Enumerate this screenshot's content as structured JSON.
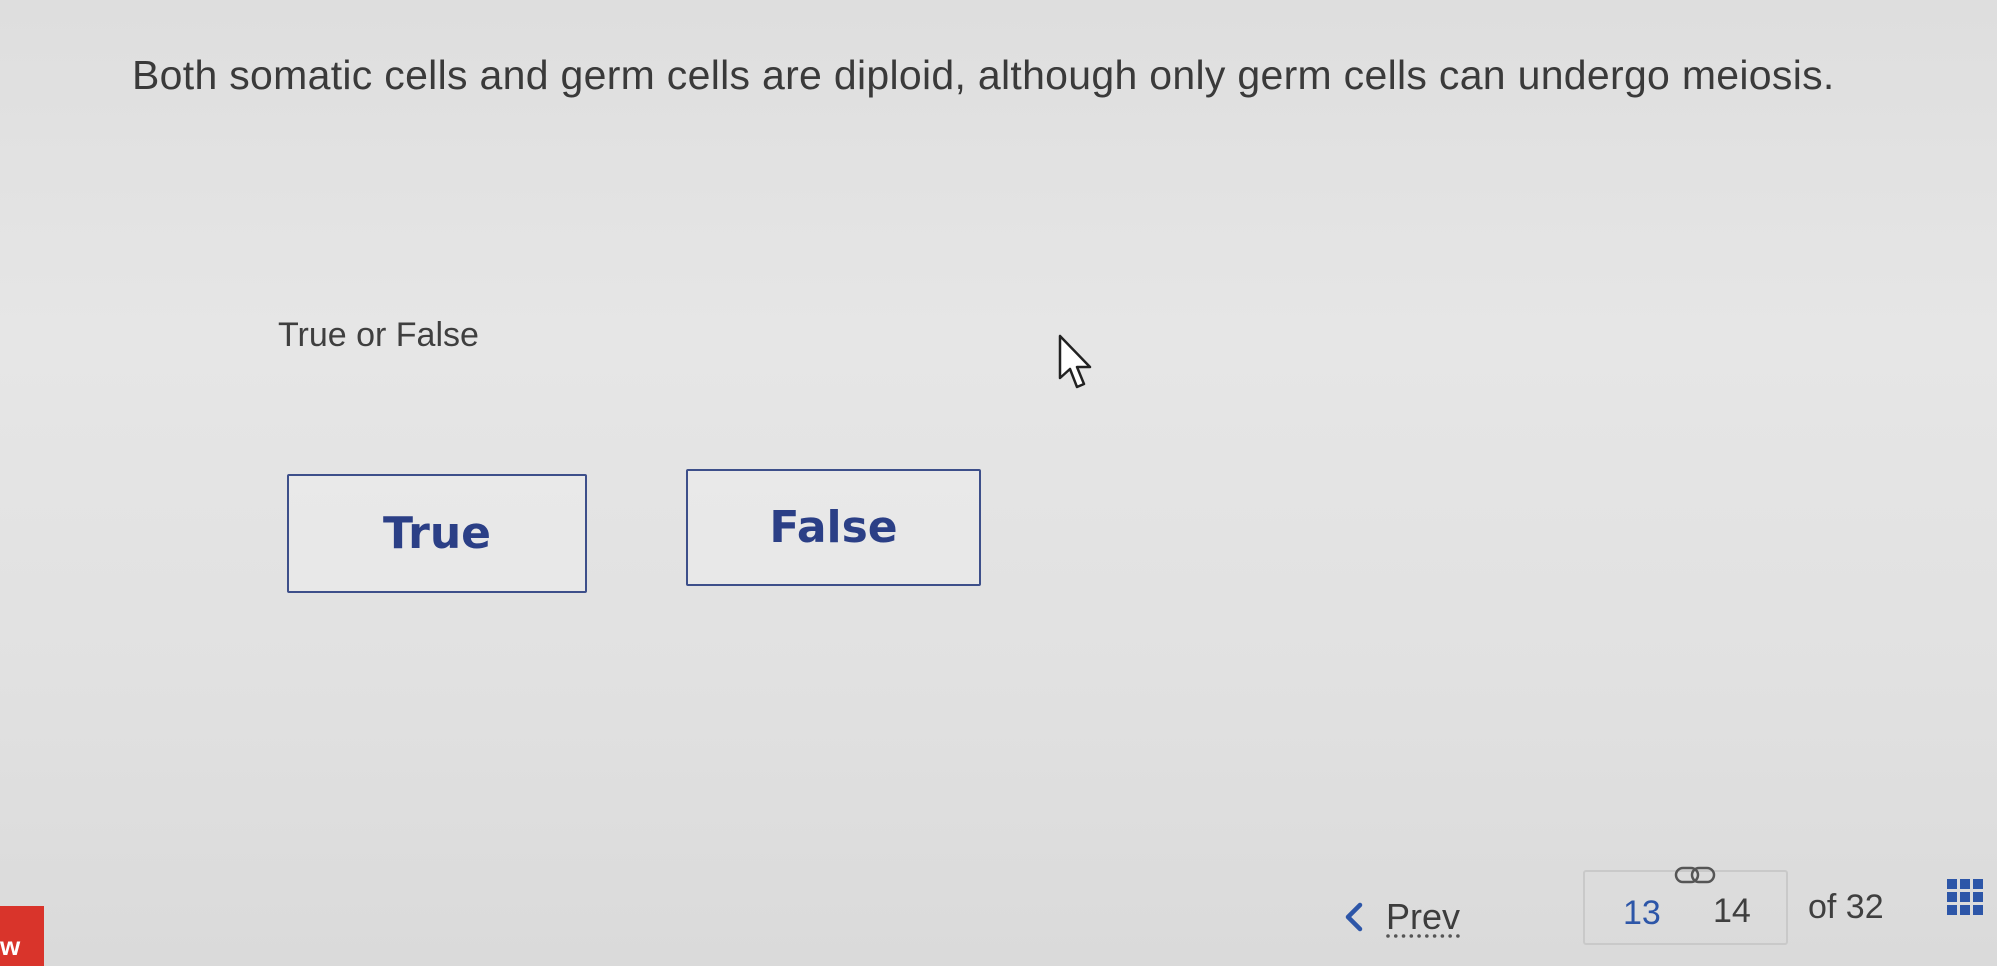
{
  "question": {
    "text": "Both somatic cells and germ cells are diploid, although only germ cells can undergo meiosis."
  },
  "prompt": {
    "label": "True or False"
  },
  "answers": [
    {
      "label": "True"
    },
    {
      "label": "False"
    }
  ],
  "navigation": {
    "prev_label": "Prev",
    "current_page": "13",
    "next_page": "14",
    "total_label": "of 32"
  },
  "brand": {
    "text": "w"
  },
  "colors": {
    "accent_blue": "#2b3f86",
    "brand_red": "#d9342b"
  }
}
